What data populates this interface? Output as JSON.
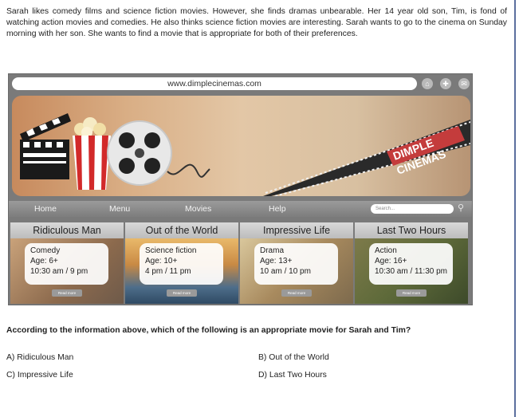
{
  "passage": "Sarah likes comedy films and science fiction movies. However, she finds dramas unbearable. Her 14 year old son, Tim, is fond of watching action movies and comedies. He also thinks science fiction movies are interesting. Sarah wants to go to the cinema on Sunday morning with her son. She wants to find a movie that is appropriate for both of their preferences.",
  "browser": {
    "url": "www.dimplecinemas.com",
    "toolbar_icons": [
      "home-icon",
      "plus-icon",
      "mail-icon"
    ],
    "logo_text": [
      "DIMPLE",
      "CINEMAS"
    ]
  },
  "nav": {
    "items": [
      "Home",
      "Menu",
      "Movies",
      "Help"
    ],
    "search_placeholder": "Search..."
  },
  "movies": [
    {
      "title": "Ridiculous Man",
      "genre": "Comedy",
      "age": "Age: 6+",
      "times": "10:30 am / 9 pm",
      "readmore": "Read more"
    },
    {
      "title": "Out of the World",
      "genre": "Science fiction",
      "age": "Age: 10+",
      "times": "4 pm / 11 pm",
      "readmore": "Read more"
    },
    {
      "title": "Impressive Life",
      "genre": "Drama",
      "age": "Age: 13+",
      "times": "10 am / 10 pm",
      "readmore": "Read more"
    },
    {
      "title": "Last Two Hours",
      "genre": "Action",
      "age": "Age: 16+",
      "times": "10:30 am / 11:30 pm",
      "readmore": "Read more"
    }
  ],
  "question": "According to the information above, which of the following is an appropriate movie for Sarah and Tim?",
  "options": [
    "A) Ridiculous Man",
    "B) Out of the World",
    "C) Impressive Life",
    "D) Last Two Hours"
  ]
}
